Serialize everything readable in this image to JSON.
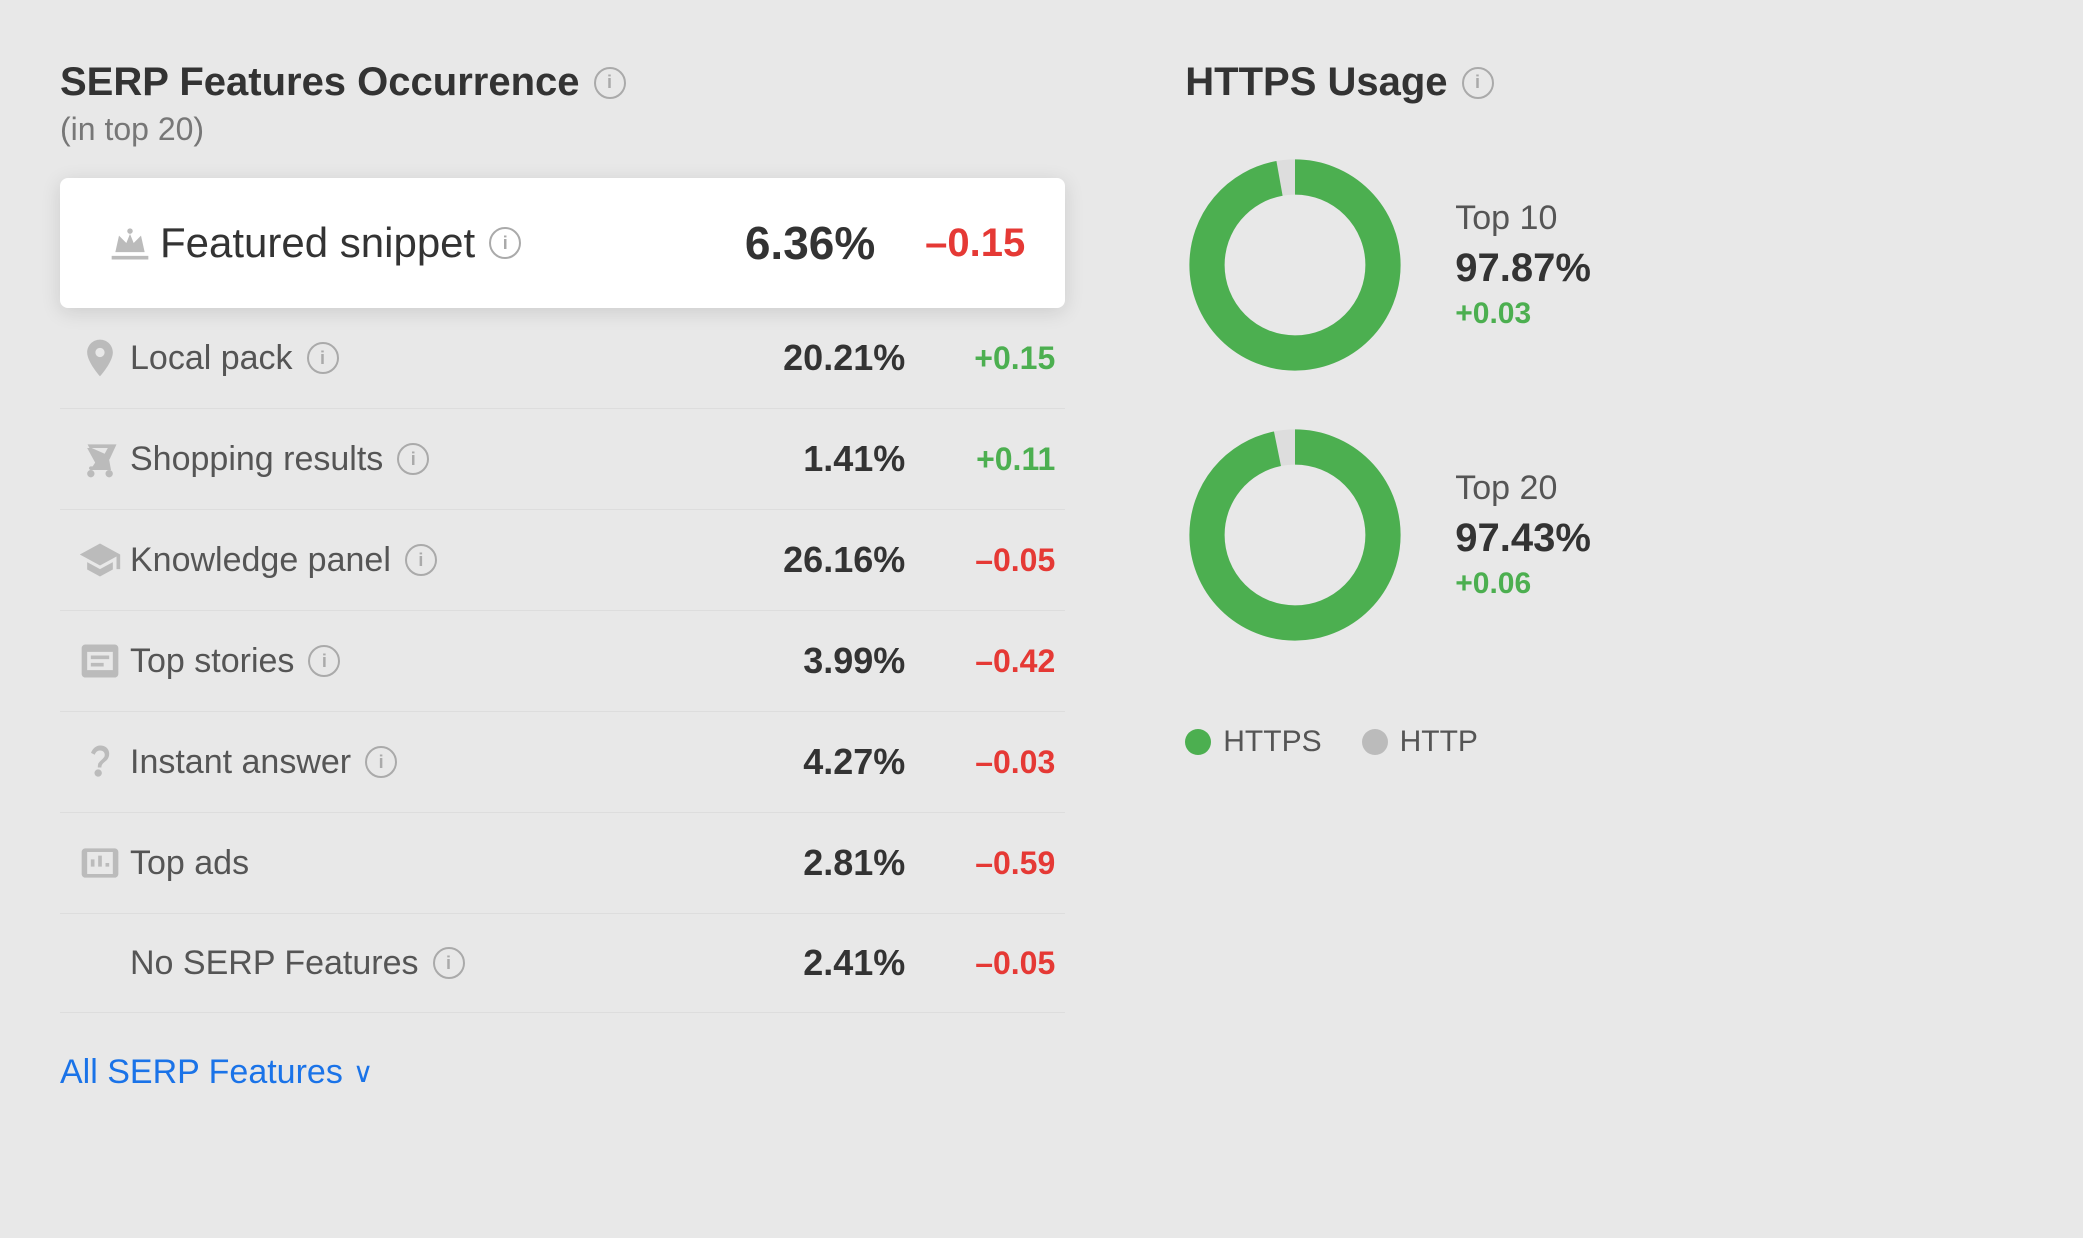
{
  "left": {
    "title": "SERP Features Occurrence",
    "info_icon": "i",
    "subtitle": "(in top 20)",
    "rows": [
      {
        "id": "featured-snippet",
        "name": "Featured snippet",
        "has_info": true,
        "pct": "6.36%",
        "delta": "–0.15",
        "delta_type": "negative",
        "icon": "crown",
        "highlighted": true
      },
      {
        "id": "local-pack",
        "name": "Local pack",
        "has_info": true,
        "pct": "20.21%",
        "delta": "+0.15",
        "delta_type": "positive",
        "icon": "pin"
      },
      {
        "id": "shopping-results",
        "name": "Shopping results",
        "has_info": true,
        "pct": "1.41%",
        "delta": "+0.11",
        "delta_type": "positive",
        "icon": "cart"
      },
      {
        "id": "knowledge-panel",
        "name": "Knowledge panel",
        "has_info": true,
        "pct": "26.16%",
        "delta": "–0.05",
        "delta_type": "negative",
        "icon": "graduation"
      },
      {
        "id": "top-stories",
        "name": "Top stories",
        "has_info": true,
        "pct": "3.99%",
        "delta": "–0.42",
        "delta_type": "negative",
        "icon": "news"
      },
      {
        "id": "instant-answer",
        "name": "Instant answer",
        "has_info": true,
        "pct": "4.27%",
        "delta": "–0.03",
        "delta_type": "negative",
        "icon": "question"
      },
      {
        "id": "top-ads",
        "name": "Top ads",
        "has_info": false,
        "pct": "2.81%",
        "delta": "–0.59",
        "delta_type": "negative",
        "icon": "ad"
      },
      {
        "id": "no-serp",
        "name": "No SERP Features",
        "has_info": true,
        "pct": "2.41%",
        "delta": "–0.05",
        "delta_type": "negative",
        "icon": "none"
      }
    ],
    "all_features_label": "All SERP Features",
    "chevron": "∨"
  },
  "right": {
    "title": "HTTPS Usage",
    "info_icon": "i",
    "top10": {
      "label": "Top 10",
      "pct": "97.87%",
      "delta": "+0.03",
      "delta_type": "positive",
      "https_pct": 97.87
    },
    "top20": {
      "label": "Top 20",
      "pct": "97.43%",
      "delta": "+0.06",
      "delta_type": "positive",
      "https_pct": 97.43
    },
    "legend": {
      "https_label": "HTTPS",
      "http_label": "HTTP"
    }
  }
}
